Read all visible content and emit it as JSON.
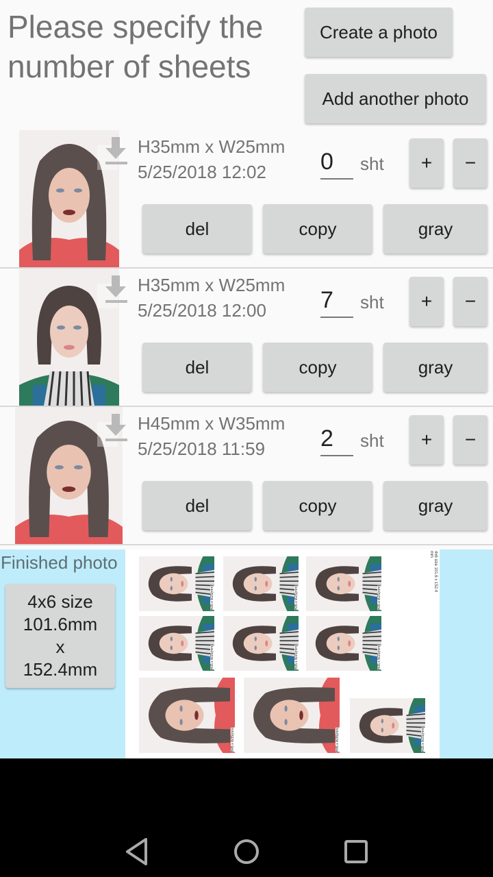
{
  "header": {
    "title": "Please specify the number of sheets",
    "create_photo_label": "Create a photo",
    "add_photo_label": "Add another photo"
  },
  "photos": [
    {
      "size": "H35mm x W25mm",
      "date": "5/25/2018 12:02",
      "sheets": "0",
      "unit": "sht",
      "plus": "+",
      "minus": "−",
      "del": "del",
      "copy": "copy",
      "gray": "gray",
      "icon": "download-icon"
    },
    {
      "size": "H35mm x W25mm",
      "date": "5/25/2018 12:00",
      "sheets": "7",
      "unit": "sht",
      "plus": "+",
      "minus": "−",
      "del": "del",
      "copy": "copy",
      "gray": "gray",
      "icon": "download-icon"
    },
    {
      "size": "H45mm x W35mm",
      "date": "5/25/2018 11:59",
      "sheets": "2",
      "unit": "sht",
      "plus": "+",
      "minus": "−",
      "del": "del",
      "copy": "copy",
      "gray": "gray",
      "icon": "download-icon"
    }
  ],
  "finished": {
    "label": "Finished photo",
    "size_button": {
      "line1": "4x6 size",
      "line2": "101.6mm",
      "line3": "x",
      "line4": "152.4mm"
    },
    "sheet_caption": "4x6 size 101.6 x 152.4 mm",
    "thumb_labels": {
      "small": "H35 x W25(mm)",
      "large": "H45 x W35(mm)"
    }
  },
  "colors": {
    "background": "#fafafa",
    "button": "#d6d7d7",
    "finished_bg": "#bfecfb",
    "navbar": "#000000"
  },
  "navbar": {
    "back": "back-icon",
    "home": "home-icon",
    "recents": "recents-icon"
  }
}
